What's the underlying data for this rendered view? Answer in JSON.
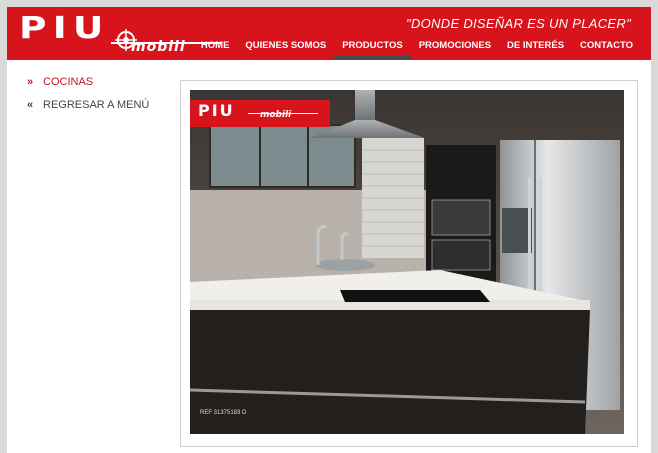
{
  "brand": {
    "logo_main": "PIU",
    "logo_sub": "mobili",
    "tagline": "\"DONDE DISEÑAR ES UN PLACER\""
  },
  "nav": {
    "items": [
      {
        "label": "HOME"
      },
      {
        "label": "QUIENES SOMOS"
      },
      {
        "label": "PRODUCTOS"
      },
      {
        "label": "PROMOCIONES"
      },
      {
        "label": "DE INTERÉS"
      },
      {
        "label": "CONTACTO"
      }
    ],
    "active_index": 2
  },
  "sidebar": {
    "items": [
      {
        "icon": "double-chevron-right-icon",
        "label": "COCINAS"
      },
      {
        "icon": "double-chevron-left-icon",
        "label": "REGRESAR A MENÚ"
      }
    ]
  },
  "photo": {
    "badge_main": "PIU",
    "badge_sub": "mobili",
    "ref_text": "REF 31375183 D"
  },
  "colors": {
    "brand_red": "#d7141c",
    "active_link": "#c8141c"
  }
}
